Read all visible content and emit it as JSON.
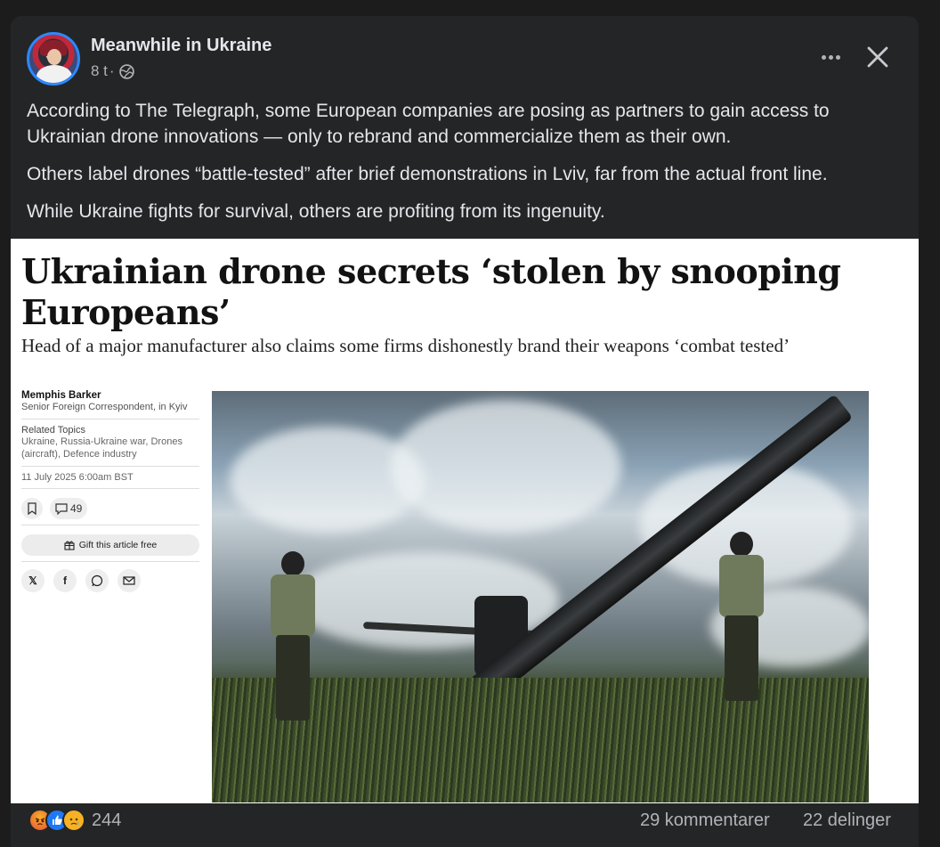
{
  "post": {
    "page_name": "Meanwhile in Ukraine",
    "time": "8 t",
    "separator": "·",
    "paragraphs": [
      "According to The Telegraph, some European companies are posing as partners to gain access to Ukrainian drone innovations — only to rebrand and commercialize them as their own.",
      "Others label drones “battle-tested” after brief demonstrations in Lviv, far from the actual front line.",
      "While Ukraine fights for survival, others are profiting from its ingenuity."
    ]
  },
  "article": {
    "headline": "Ukrainian drone secrets ‘stolen by snooping Europeans’",
    "subhead": "Head of a major manufacturer also claims some firms dishonestly brand their weapons ‘combat tested’",
    "author": "Memphis Barker",
    "role": "Senior Foreign Correspondent, in Kyiv",
    "related_title": "Related Topics",
    "related_topics": "Ukraine, Russia-Ukraine war, Drones (aircraft), Defence industry",
    "date": "11 July 2025 6:00am BST",
    "comment_count": "49",
    "gift_label": "Gift this article free",
    "share_x": "𝕏",
    "share_f": "f"
  },
  "footer": {
    "reaction_count": "244",
    "comments": "29 kommentarer",
    "shares": "22 delinger"
  },
  "icons": {
    "more": "more-icon",
    "close": "close-icon",
    "globe": "globe-icon",
    "bookmark": "bookmark-icon",
    "comment": "comment-icon",
    "gift": "gift-icon",
    "whatsapp": "whatsapp-icon",
    "email": "email-icon",
    "reactions": [
      "angry-icon",
      "like-icon",
      "sad-icon"
    ]
  },
  "colors": {
    "background": "#1c1c1d",
    "card": "#242526",
    "text": "#e4e6eb",
    "secondary_text": "#b0b3b8",
    "accent": "#2d88ff"
  }
}
